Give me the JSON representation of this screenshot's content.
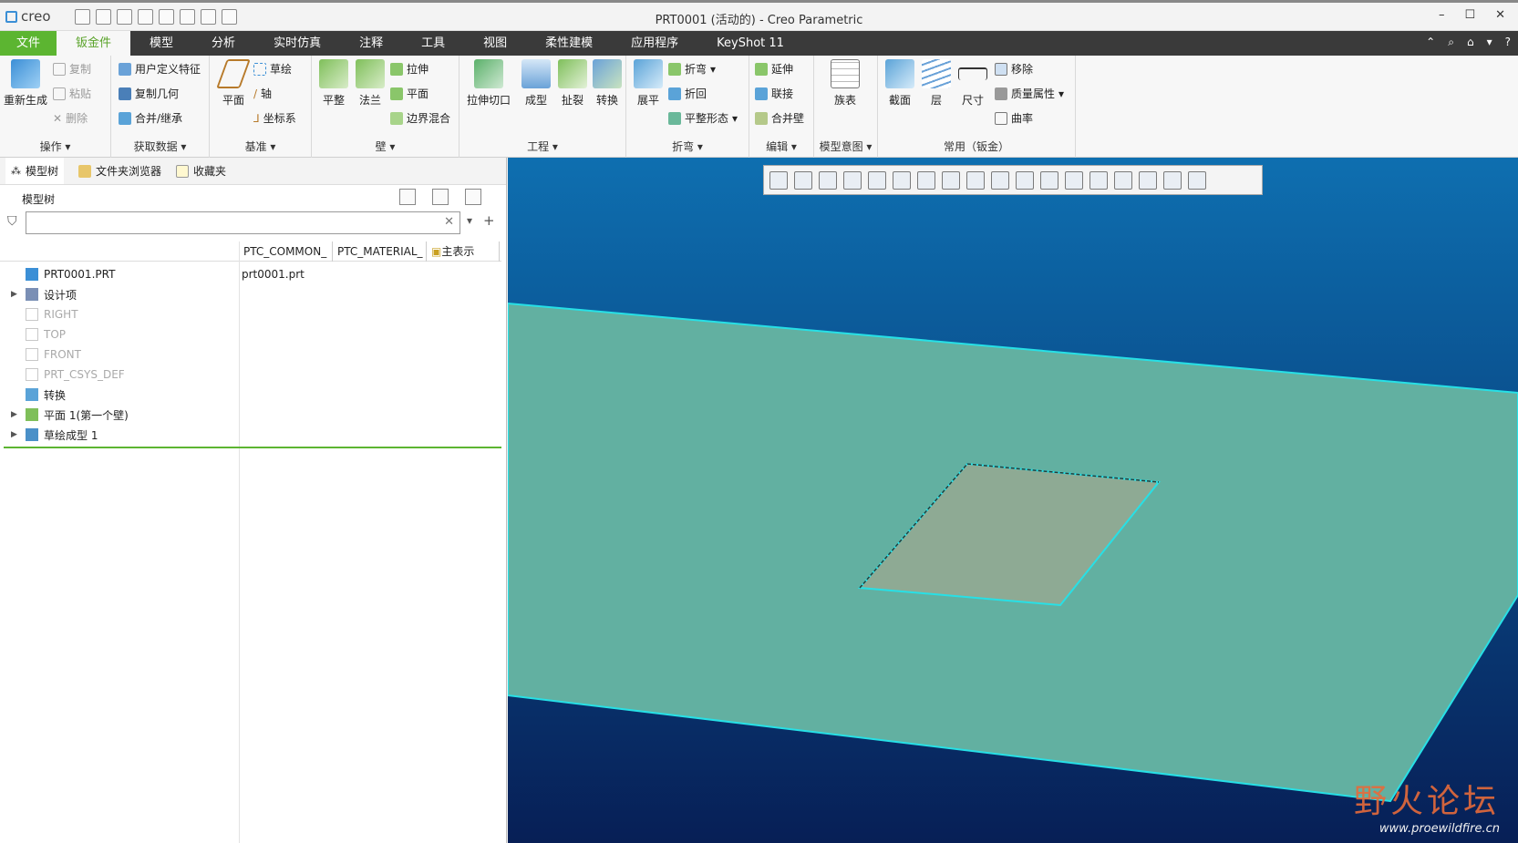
{
  "app": {
    "logo": "creo",
    "title": "PRT0001 (活动的) - Creo Parametric",
    "window_buttons": [
      "–",
      "☐",
      "✕"
    ]
  },
  "tabs": [
    "文件",
    "钣金件",
    "模型",
    "分析",
    "实时仿真",
    "注释",
    "工具",
    "视图",
    "柔性建模",
    "应用程序",
    "KeyShot 11"
  ],
  "tabbar_right": [
    "⌃",
    "⌕",
    "⌂",
    "▾",
    "?"
  ],
  "ribbon": {
    "ops": {
      "label": "操作",
      "regen": "重新生成",
      "copy": "复制",
      "paste": "粘贴",
      "delete": "删除"
    },
    "getdata": {
      "label": "获取数据",
      "udf": "用户定义特征",
      "copygeom": "复制几何",
      "merge": "合并/继承"
    },
    "datum": {
      "label": "基准",
      "plane": "平面",
      "sketch": "草绘",
      "axis": "轴",
      "csys": "坐标系"
    },
    "wall": {
      "label": "壁",
      "flat": "平整",
      "flange": "法兰",
      "extrude": "拉伸",
      "planar": "平面",
      "blend": "边界混合"
    },
    "eng": {
      "label": "工程",
      "cut": "拉伸切口",
      "form": "成型",
      "rip": "扯裂",
      "convert": "转换"
    },
    "bend": {
      "label": "折弯",
      "unbend": "展平",
      "bend": "折弯",
      "bendback": "折回",
      "flatpattern": "平整形态"
    },
    "edit": {
      "label": "编辑",
      "extend": "延伸",
      "join": "联接",
      "mergewall": "合并壁"
    },
    "intent": {
      "label": "模型意图",
      "family": "族表"
    },
    "common": {
      "label": "常用（钣金）",
      "section": "截面",
      "layer": "层",
      "dim": "尺寸",
      "remove": "移除",
      "mass": "质量属性",
      "curvature": "曲率"
    }
  },
  "panel": {
    "tabs": [
      "模型树",
      "文件夹浏览器",
      "收藏夹"
    ],
    "title": "模型树",
    "filter_placeholder": "",
    "columns": [
      "PTC_COMMON_",
      "PTC_MATERIAL_",
      "主表示"
    ],
    "rows": [
      {
        "label": "PRT0001.PRT",
        "value": "prt0001.prt",
        "icon": "part-icon",
        "grey": false,
        "expand": ""
      },
      {
        "label": "设计项",
        "value": "",
        "icon": "design-items-icon",
        "grey": false,
        "expand": "▶"
      },
      {
        "label": "RIGHT",
        "value": "",
        "icon": "datum-plane-icon",
        "grey": true,
        "expand": ""
      },
      {
        "label": "TOP",
        "value": "",
        "icon": "datum-plane-icon",
        "grey": true,
        "expand": ""
      },
      {
        "label": "FRONT",
        "value": "",
        "icon": "datum-plane-icon",
        "grey": true,
        "expand": ""
      },
      {
        "label": "PRT_CSYS_DEF",
        "value": "",
        "icon": "csys-icon",
        "grey": true,
        "expand": ""
      },
      {
        "label": "转换",
        "value": "",
        "icon": "convert-icon",
        "grey": false,
        "expand": ""
      },
      {
        "label": "平面 1(第一个壁)",
        "value": "",
        "icon": "flat-wall-icon",
        "grey": false,
        "expand": "▶"
      },
      {
        "label": "草绘成型 1",
        "value": "",
        "icon": "form-icon",
        "grey": false,
        "expand": "▶"
      }
    ]
  },
  "watermark": {
    "title": "野火论坛",
    "url": "www.proewildfire.cn"
  },
  "colors": {
    "accent": "#5cb531",
    "plate": "#62b0a1",
    "edge": "#27e0e6",
    "cutout": "#8eaa94"
  }
}
